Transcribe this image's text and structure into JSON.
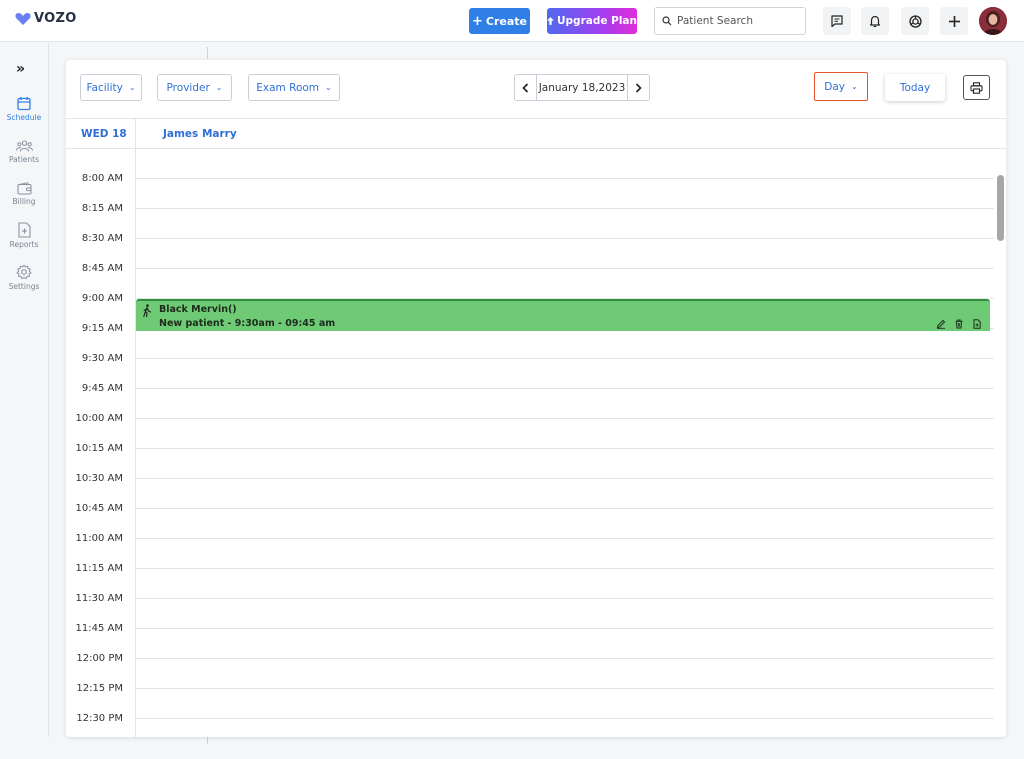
{
  "brand": {
    "name": "VOZO",
    "color": "#6b7ff5"
  },
  "topbar": {
    "create_label": "Create",
    "upgrade_label": "Upgrade Plan",
    "search_placeholder": "Patient Search"
  },
  "sidebar": {
    "items": [
      {
        "label": "Schedule",
        "icon": "calendar-icon",
        "active": true
      },
      {
        "label": "Patients",
        "icon": "people-icon"
      },
      {
        "label": "Billing",
        "icon": "wallet-icon"
      },
      {
        "label": "Reports",
        "icon": "report-icon"
      },
      {
        "label": "Settings",
        "icon": "gear-icon"
      }
    ]
  },
  "filters": {
    "facility": "Facility",
    "provider": "Provider",
    "exam_room": "Exam Room"
  },
  "date_nav": {
    "date": "January 18,2023"
  },
  "view": {
    "mode": "Day",
    "today": "Today"
  },
  "calendar": {
    "day_label": "WED 18",
    "provider": "James Marry",
    "times": [
      "8:00 AM",
      "8:15 AM",
      "8:30 AM",
      "8:45 AM",
      "9:00 AM",
      "9:15 AM",
      "9:30 AM",
      "9:45 AM",
      "10:00 AM",
      "10:15 AM",
      "10:30 AM",
      "10:45 AM",
      "11:00 AM",
      "11:15 AM",
      "11:30 AM",
      "11:45 AM",
      "12:00 PM",
      "12:15 PM",
      "12:30 PM"
    ]
  },
  "appointment": {
    "patient": "Black Mervin()",
    "details": "New patient - 9:30am - 09:45 am",
    "color": "#6fca75"
  },
  "colors": {
    "accent": "#2f7fe6",
    "highlight": "#e8542f"
  }
}
